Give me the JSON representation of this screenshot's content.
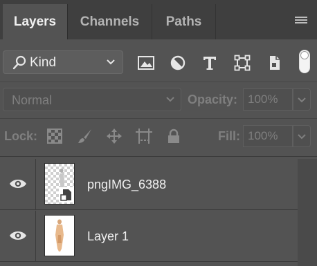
{
  "panel": {
    "tabs": [
      {
        "label": "Layers",
        "active": true
      },
      {
        "label": "Channels",
        "active": false
      },
      {
        "label": "Paths",
        "active": false
      }
    ],
    "menu_icon": "hamburger-menu-icon"
  },
  "filter": {
    "kind_label": "Kind",
    "icons": [
      "image-filter-icon",
      "adjustment-filter-icon",
      "type-filter-icon",
      "shape-filter-icon",
      "smart-object-filter-icon"
    ]
  },
  "blend": {
    "mode": "Normal",
    "opacity_label": "Opacity:",
    "opacity_value": "100%"
  },
  "lock": {
    "label": "Lock:",
    "icons": [
      "lock-transparent-pixels-icon",
      "lock-image-pixels-icon",
      "lock-position-icon",
      "lock-artboard-icon",
      "lock-all-icon"
    ],
    "fill_label": "Fill:",
    "fill_value": "100%"
  },
  "layers": [
    {
      "name": "pngIMG_6388",
      "visible": true,
      "thumb": "transparent-smart-object"
    },
    {
      "name": "Layer 1",
      "visible": true,
      "thumb": "white-figure"
    }
  ],
  "colors": {
    "panel_bg": "#535353",
    "tabbar_bg": "#3f3f3f",
    "text_active": "#f0f0f0",
    "text_dim": "#7f7f7f"
  }
}
